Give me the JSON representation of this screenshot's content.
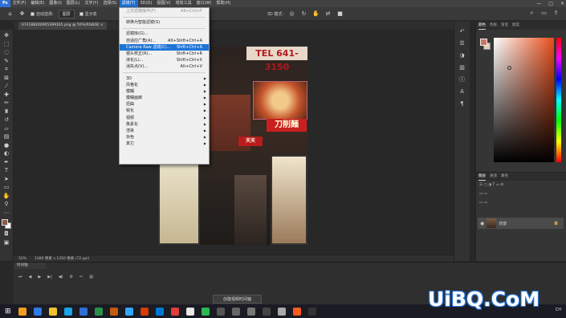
{
  "menubar": {
    "items": [
      "文件(F)",
      "编辑(E)",
      "图像(I)",
      "图层(L)",
      "文字(Y)",
      "选择(S)",
      "滤镜(T)",
      "3D(D)",
      "视图(V)",
      "增效工具",
      "窗口(W)",
      "帮助(H)"
    ],
    "window_controls": [
      "—",
      "□",
      "✕"
    ]
  },
  "options_bar": {
    "auto_select_label": "自动选择:",
    "auto_select_value": "图层",
    "show_transform_label": "显示变",
    "mode_3d": "3D 模式:"
  },
  "document": {
    "tab_title": "674188260905399165.png @ 50%(RGB/8)",
    "zoom": "50%",
    "doc_info": "1080 像素 x 1350 像素 (72 ppi)"
  },
  "photo_signs": {
    "phone": "TEL 641-3150",
    "noodle": "刀削麺",
    "tenjin": "天天"
  },
  "timeline": {
    "title": "时间轴",
    "create_button": "创建视频时间轴"
  },
  "color_panel": {
    "tabs": [
      "颜色",
      "色板",
      "渐变",
      "图案"
    ],
    "fg_color": "#c77761",
    "bg_color": "#e3c9b9"
  },
  "layers_panel": {
    "tabs": [
      "图层",
      "通道",
      "路径"
    ],
    "layer_name": "背景"
  },
  "filter_menu": {
    "items": [
      {
        "label": "上次滤镜操作(F)",
        "shortcut": "Alt+Ctrl+F",
        "disabled": true
      },
      {
        "sep": true
      },
      {
        "label": "转换为智能滤镜(S)",
        "shortcut": ""
      },
      {
        "sep": true
      },
      {
        "label": "滤镜库(G)...",
        "shortcut": ""
      },
      {
        "label": "自适应广角(A)...",
        "shortcut": "Alt+Shift+Ctrl+A"
      },
      {
        "label": "Camera Raw 滤镜(C)...",
        "shortcut": "Shift+Ctrl+A",
        "highlighted": true
      },
      {
        "label": "镜头校正(R)...",
        "shortcut": "Shift+Ctrl+R"
      },
      {
        "label": "液化(L)...",
        "shortcut": "Shift+Ctrl+X"
      },
      {
        "label": "消失点(V)...",
        "shortcut": "Alt+Ctrl+V"
      },
      {
        "sep": true
      },
      {
        "label": "3D",
        "submenu": true
      },
      {
        "label": "风格化",
        "submenu": true
      },
      {
        "label": "模糊",
        "submenu": true
      },
      {
        "label": "模糊画廊",
        "submenu": true
      },
      {
        "label": "扭曲",
        "submenu": true
      },
      {
        "label": "锐化",
        "submenu": true
      },
      {
        "label": "视频",
        "submenu": true
      },
      {
        "label": "像素化",
        "submenu": true
      },
      {
        "label": "渲染",
        "submenu": true
      },
      {
        "label": "杂色",
        "submenu": true
      },
      {
        "label": "其它",
        "submenu": true
      }
    ]
  },
  "taskbar": {
    "tray_text": "CH",
    "icon_colors": [
      "#f0a020",
      "#2c7be5",
      "#f2c12e",
      "#1aa3e8",
      "#2f6fd6",
      "#2b9148",
      "#c55a11",
      "#31a8ff",
      "#d83b01",
      "#0078d4",
      "#e03d3d",
      "#e8e8e8",
      "#2db84d",
      "#555",
      "#666",
      "#777",
      "#444",
      "#aaa",
      "#ff5a1f",
      "#333"
    ]
  },
  "watermark": "UiBQ.CoM"
}
